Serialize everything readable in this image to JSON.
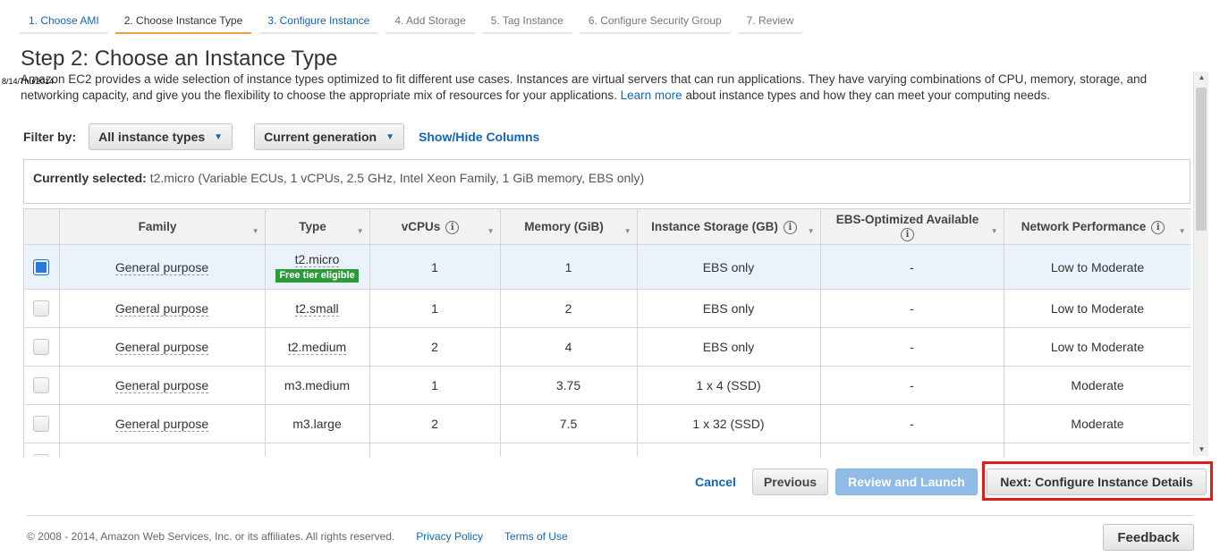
{
  "wizard": {
    "tabs": [
      {
        "label": "1. Choose AMI"
      },
      {
        "label": "2. Choose Instance Type"
      },
      {
        "label": "3. Configure Instance"
      },
      {
        "label": "4. Add Storage"
      },
      {
        "label": "5. Tag Instance"
      },
      {
        "label": "6. Configure Security Group"
      },
      {
        "label": "7. Review"
      }
    ]
  },
  "page": {
    "title": "Step 2: Choose an Instance Type",
    "timestamp": "8/14/Thu/2014",
    "description_before": "Amazon EC2 provides a wide selection of instance types optimized to fit different use cases. Instances are virtual servers that can run applications. They have varying combinations of CPU, memory, storage, and networking capacity, and give you the flexibility to choose the appropriate mix of resources for your applications.",
    "learn_more": "Learn more",
    "description_after": "about instance types and how they can meet your computing needs."
  },
  "filter": {
    "label": "Filter by:",
    "instance_types": "All instance types",
    "generation": "Current generation",
    "show_hide": "Show/Hide Columns"
  },
  "selection": {
    "label": "Currently selected:",
    "value": "t2.micro (Variable ECUs, 1 vCPUs, 2.5 GHz, Intel Xeon Family, 1 GiB memory, EBS only)"
  },
  "table": {
    "headers": {
      "family": "Family",
      "type": "Type",
      "vcpus": "vCPUs",
      "memory": "Memory (GiB)",
      "storage": "Instance Storage (GB)",
      "ebs": "EBS-Optimized Available",
      "network": "Network Performance"
    },
    "free_tier_badge": "Free tier eligible",
    "rows": [
      {
        "family": "General purpose",
        "type": "t2.micro",
        "vcpus": "1",
        "memory": "1",
        "storage": "EBS only",
        "ebs": "-",
        "network": "Low to Moderate"
      },
      {
        "family": "General purpose",
        "type": "t2.small",
        "vcpus": "1",
        "memory": "2",
        "storage": "EBS only",
        "ebs": "-",
        "network": "Low to Moderate"
      },
      {
        "family": "General purpose",
        "type": "t2.medium",
        "vcpus": "2",
        "memory": "4",
        "storage": "EBS only",
        "ebs": "-",
        "network": "Low to Moderate"
      },
      {
        "family": "General purpose",
        "type": "m3.medium",
        "vcpus": "1",
        "memory": "3.75",
        "storage": "1 x 4 (SSD)",
        "ebs": "-",
        "network": "Moderate"
      },
      {
        "family": "General purpose",
        "type": "m3.large",
        "vcpus": "2",
        "memory": "7.5",
        "storage": "1 x 32 (SSD)",
        "ebs": "-",
        "network": "Moderate"
      }
    ]
  },
  "actions": {
    "cancel": "Cancel",
    "previous": "Previous",
    "review_launch": "Review and Launch",
    "next": "Next: Configure Instance Details"
  },
  "footer": {
    "copyright": "© 2008 - 2014, Amazon Web Services, Inc. or its affiliates. All rights reserved.",
    "privacy": "Privacy Policy",
    "terms": "Terms of Use",
    "feedback": "Feedback"
  }
}
